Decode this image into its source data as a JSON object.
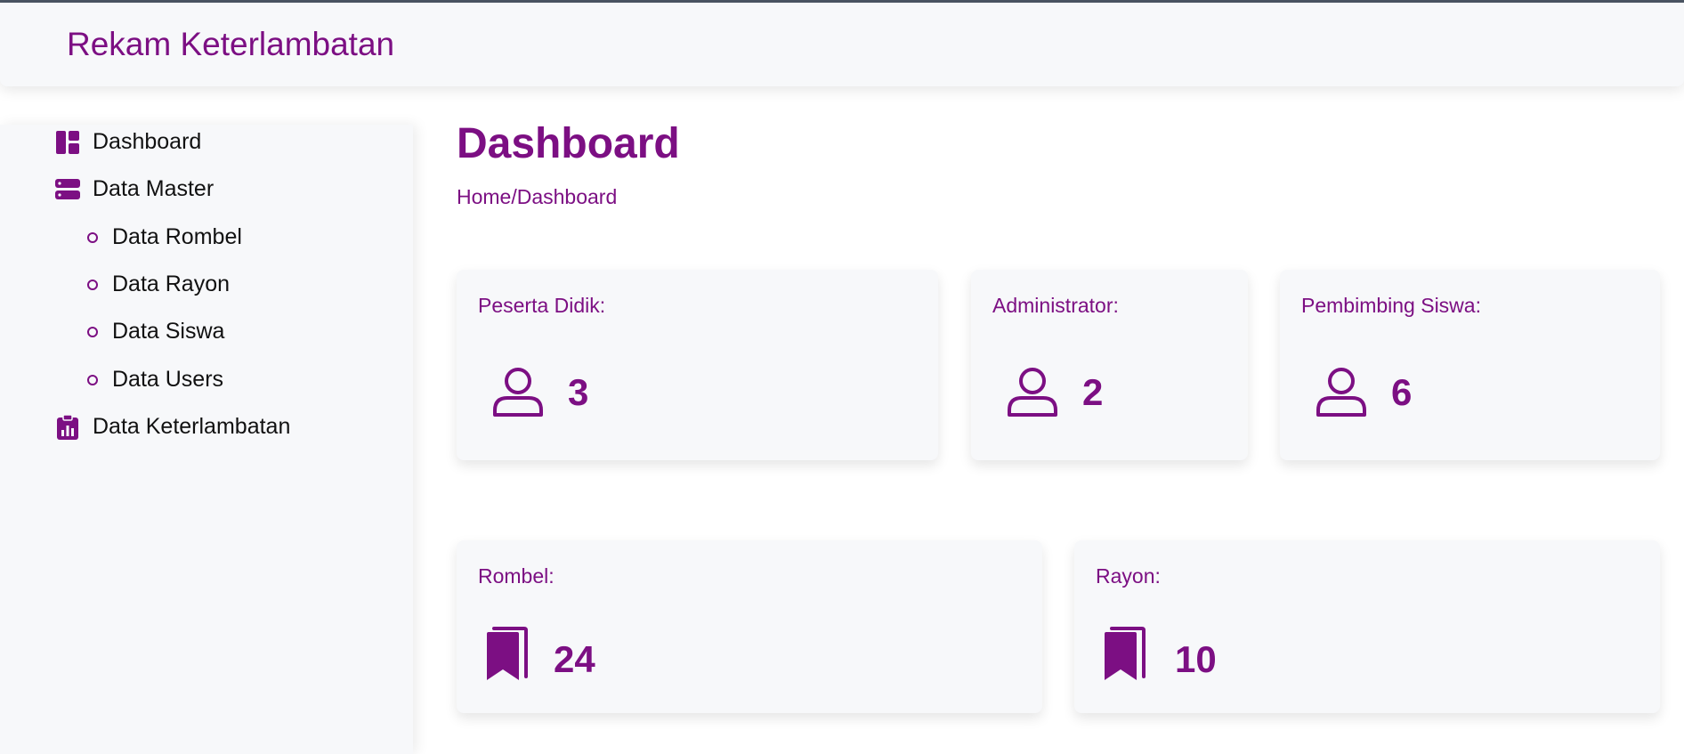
{
  "app": {
    "title": "Rekam Keterlambatan"
  },
  "sidebar": {
    "items": [
      {
        "label": "Dashboard",
        "icon": "dashboard-icon"
      },
      {
        "label": "Data Master",
        "icon": "server-icon"
      },
      {
        "label": "Data Keterlambatan",
        "icon": "clipboard-chart-icon"
      }
    ],
    "subitems": [
      {
        "label": "Data Rombel"
      },
      {
        "label": "Data Rayon"
      },
      {
        "label": "Data Siswa"
      },
      {
        "label": "Data Users"
      }
    ]
  },
  "main": {
    "title": "Dashboard",
    "breadcrumb": "Home/Dashboard",
    "cards": [
      {
        "label": "Peserta Didik:",
        "value": "3",
        "icon": "person-icon"
      },
      {
        "label": "Administrator:",
        "value": "2",
        "icon": "person-icon"
      },
      {
        "label": "Pembimbing Siswa:",
        "value": "6",
        "icon": "person-icon"
      },
      {
        "label": "Rombel:",
        "value": "24",
        "icon": "bookmarks-icon"
      },
      {
        "label": "Rayon:",
        "value": "10",
        "icon": "bookmarks-icon"
      }
    ]
  },
  "colors": {
    "accent": "#7c0f83",
    "panel": "#f7f8fa"
  }
}
